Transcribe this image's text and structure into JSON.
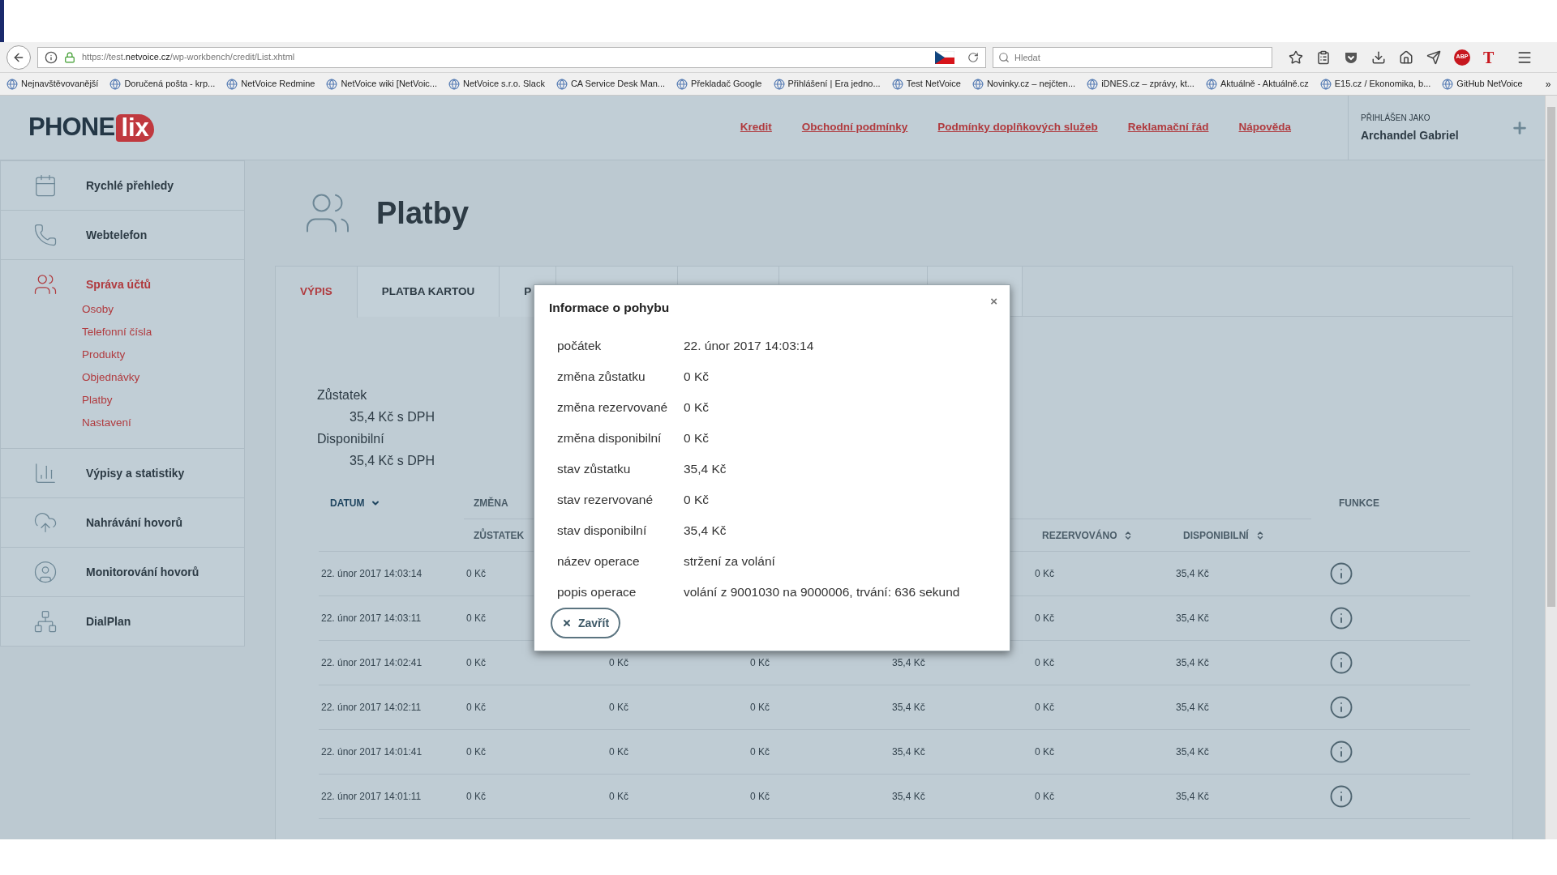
{
  "browser": {
    "url": {
      "prefix": "https://test.",
      "domain": "netvoice.cz",
      "path": "/wp-workbench/credit/List.xhtml"
    },
    "search": {
      "placeholder": "Hledat"
    },
    "addon_abp": "ABP",
    "addon_t": "T",
    "bookmarks": [
      {
        "label": "Nejnavštěvovanější"
      },
      {
        "label": "Doručená pošta - krp..."
      },
      {
        "label": "NetVoice Redmine"
      },
      {
        "label": "NetVoice wiki [NetVoic..."
      },
      {
        "label": "NetVoice s.r.o. Slack"
      },
      {
        "label": "CA Service Desk Man..."
      },
      {
        "label": "Překladač Google"
      },
      {
        "label": "Přihlášení | Era jedno..."
      },
      {
        "label": "Test NetVoice"
      },
      {
        "label": "Novinky.cz – nejčten..."
      },
      {
        "label": "iDNES.cz – zprávy, kt..."
      },
      {
        "label": "Aktuálně - Aktuálně.cz"
      },
      {
        "label": "E15.cz / Ekonomika, b..."
      },
      {
        "label": "GitHub NetVoice"
      }
    ],
    "more": "»"
  },
  "header": {
    "logo": {
      "dark": "PHONE",
      "light": "lix"
    },
    "nav": [
      "Kredit",
      "Obchodní podmínky",
      "Podmínky doplňkových služeb",
      "Reklamační řád",
      "Nápověda"
    ],
    "user": {
      "label": "PŘIHLÁŠEN JAKO",
      "name": "Archandel Gabriel"
    }
  },
  "sidebar": {
    "items": [
      {
        "label": "Rychlé přehledy",
        "kind": "calendar",
        "selected": false
      },
      {
        "label": "Webtelefon",
        "kind": "phone",
        "selected": false
      },
      {
        "label": "Správa účtů",
        "kind": "users",
        "selected": true,
        "children": [
          {
            "label": "Osoby"
          },
          {
            "label": "Telefonní čísla"
          },
          {
            "label": "Produkty"
          },
          {
            "label": "Objednávky"
          },
          {
            "label": "Platby"
          },
          {
            "label": "Nastavení"
          }
        ]
      },
      {
        "label": "Výpisy a statistiky",
        "kind": "chart",
        "selected": false
      },
      {
        "label": "Nahrávání hovorů",
        "kind": "cloud",
        "selected": false
      },
      {
        "label": "Monitorování hovorů",
        "kind": "monitor",
        "selected": false
      },
      {
        "label": "DialPlan",
        "kind": "plan",
        "selected": false
      }
    ]
  },
  "page": {
    "title": "Platby"
  },
  "tabs": [
    {
      "label": "VÝPIS",
      "selected": true
    },
    {
      "label": "PLATBA KARTOU",
      "selected": false
    },
    {
      "label": "P",
      "selected": false
    }
  ],
  "balance": [
    {
      "label": "Zůstatek",
      "value": "35,4 Kč s DPH"
    },
    {
      "label": "Disponibilní",
      "value": "35,4 Kč s DPH"
    }
  ],
  "table": {
    "columns_top": [
      {
        "label": "DATUM",
        "sorted": true
      },
      {
        "label": "ZMĚNA"
      },
      {
        "label": "FUNKCE"
      }
    ],
    "columns_sub": [
      {
        "label": "ZŮSTATEK",
        "sortable": false
      },
      {
        "label": "REZERVOVÁNO",
        "sortable": true
      },
      {
        "label": "DISPONIBILNÍ",
        "sortable": true
      }
    ],
    "rows": [
      {
        "cells": [
          "22. únor 2017 14:03:14",
          "0 Kč",
          null,
          null,
          null,
          "0 Kč",
          "35,4 Kč"
        ]
      },
      {
        "cells": [
          "22. únor 2017 14:03:11",
          "0 Kč",
          null,
          null,
          null,
          "0 Kč",
          "35,4 Kč"
        ]
      },
      {
        "cells": [
          "22. únor 2017 14:02:41",
          "0 Kč",
          "0 Kč",
          "0 Kč",
          "35,4 Kč",
          "0 Kč",
          "35,4 Kč"
        ]
      },
      {
        "cells": [
          "22. únor 2017 14:02:11",
          "0 Kč",
          "0 Kč",
          "0 Kč",
          "35,4 Kč",
          "0 Kč",
          "35,4 Kč"
        ]
      },
      {
        "cells": [
          "22. únor 2017 14:01:41",
          "0 Kč",
          "0 Kč",
          "0 Kč",
          "35,4 Kč",
          "0 Kč",
          "35,4 Kč"
        ]
      },
      {
        "cells": [
          "22. únor 2017 14:01:11",
          "0 Kč",
          "0 Kč",
          "0 Kč",
          "35,4 Kč",
          "0 Kč",
          "35,4 Kč"
        ]
      }
    ]
  },
  "modal": {
    "title": "Informace o pohybu",
    "close": "×",
    "fields": [
      {
        "label": "počátek",
        "value": "22. únor 2017 14:03:14"
      },
      {
        "label": "změna zůstatku",
        "value": "0 Kč"
      },
      {
        "label": "změna rezervované",
        "value": "0 Kč"
      },
      {
        "label": "změna disponibilní",
        "value": "0 Kč"
      },
      {
        "label": "stav zůstatku",
        "value": "35,4 Kč"
      },
      {
        "label": "stav rezervované",
        "value": "0 Kč"
      },
      {
        "label": "stav disponibilní",
        "value": "35,4 Kč"
      },
      {
        "label": "název operace",
        "value": "stržení za volání"
      },
      {
        "label": "popis operace",
        "value": "volání z 9001030 na 9000006, trvání: 636 sekund"
      }
    ],
    "button": "Zavřít"
  }
}
